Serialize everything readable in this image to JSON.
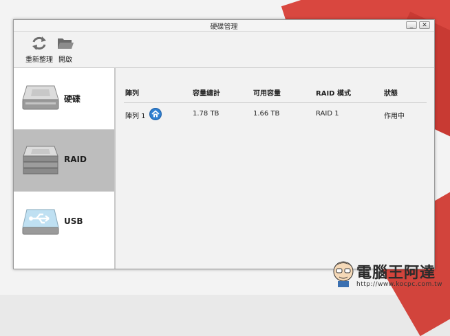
{
  "window": {
    "title": "硬碟管理",
    "minimize_glyph": "_",
    "close_glyph": "✕"
  },
  "toolbar": {
    "items": [
      {
        "label": "重新整理",
        "icon": "refresh-icon"
      },
      {
        "label": "開啟",
        "icon": "folder-open-icon"
      }
    ]
  },
  "sidebar": {
    "items": [
      {
        "label": "硬碟",
        "icon": "hard-drive-icon",
        "active": false
      },
      {
        "label": "RAID",
        "icon": "raid-drive-icon",
        "active": true
      },
      {
        "label": "USB",
        "icon": "usb-drive-icon",
        "active": false
      }
    ]
  },
  "table": {
    "headers": [
      "陣列",
      "容量總計",
      "可用容量",
      "RAID 模式",
      "狀態"
    ],
    "rows": [
      {
        "name": "陣列 1",
        "total": "1.78 TB",
        "free": "1.66 TB",
        "mode": "RAID 1",
        "status": "作用中"
      }
    ]
  },
  "watermark": {
    "text": "電腦王阿達",
    "url": "http://www.kocpc.com.tw"
  },
  "colors": {
    "accent_red": "#d9473f",
    "active_item": "#bdbdbd",
    "home_badge": "#2f7fd0"
  }
}
